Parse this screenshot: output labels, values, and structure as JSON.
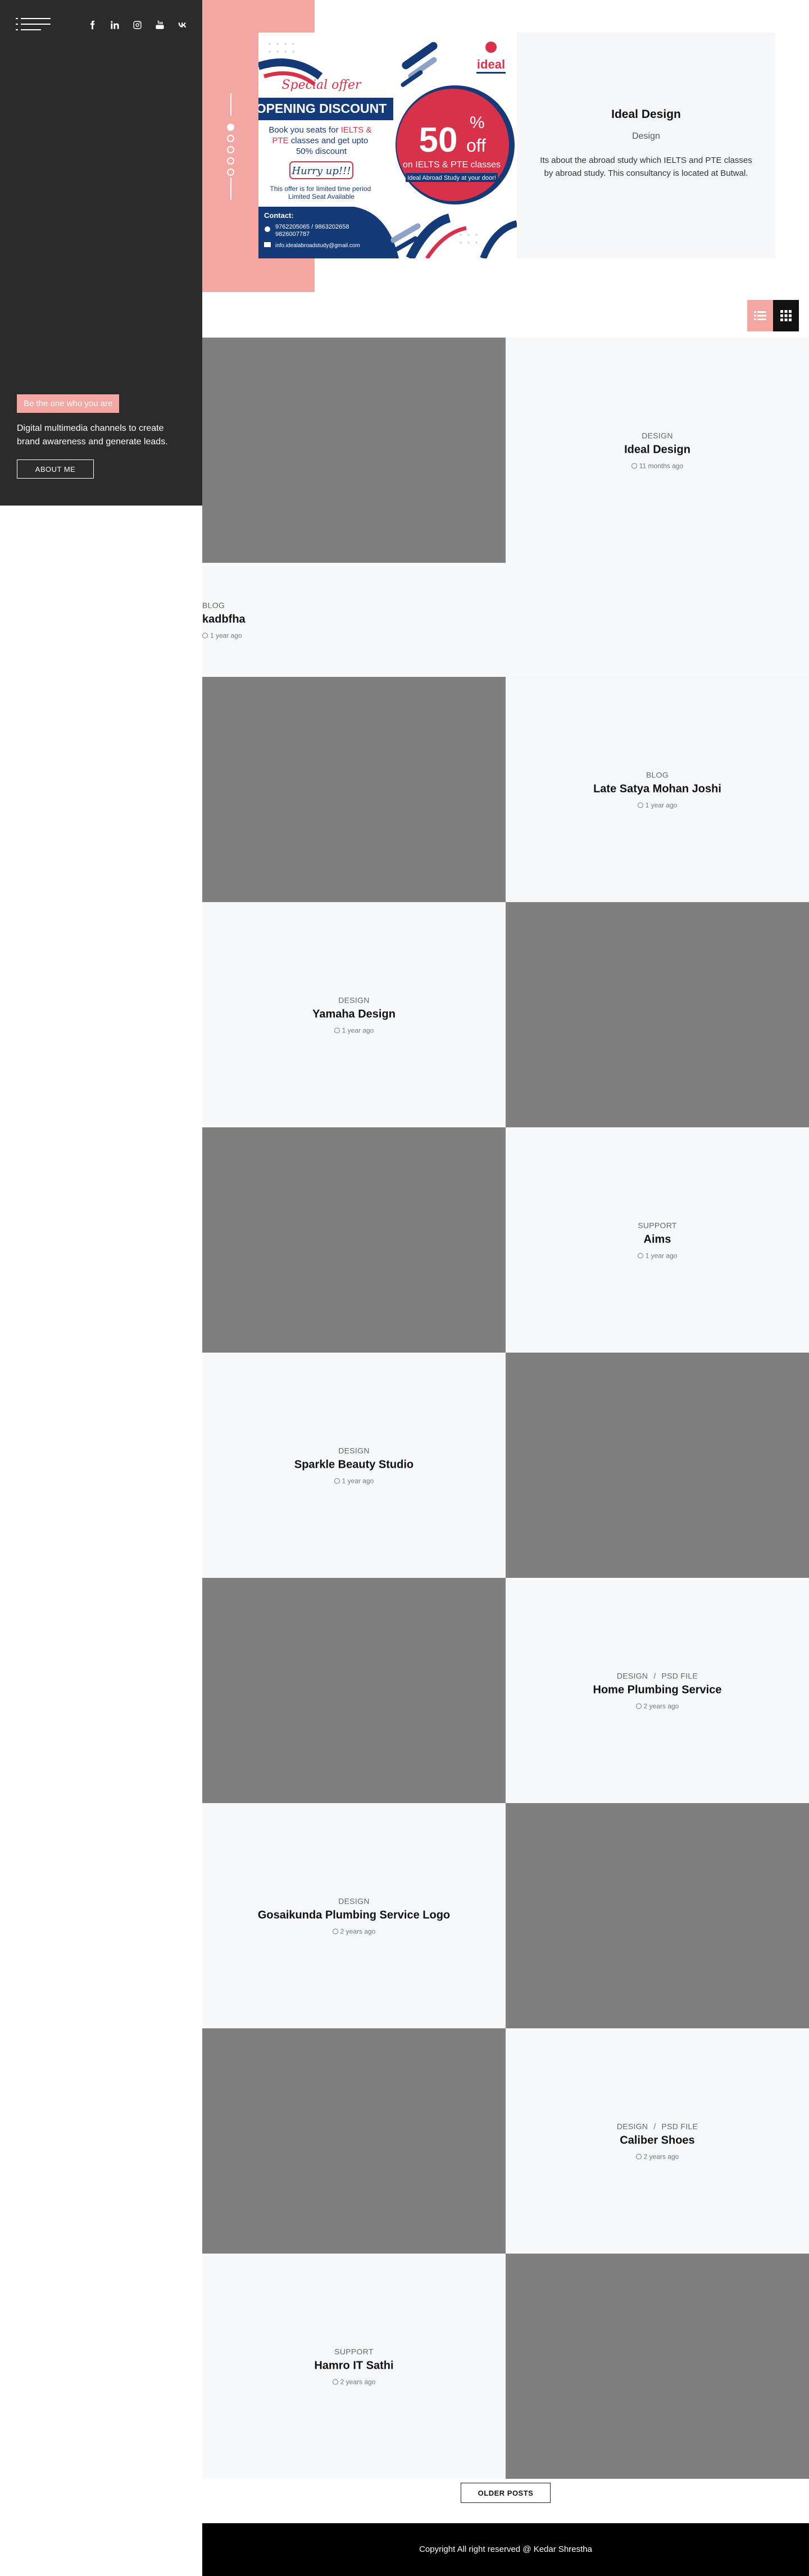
{
  "colors": {
    "sidebar": "#2b2b2b",
    "accent": "#f4a7a2",
    "placeholder": "#7f7f7f",
    "card": "#f7f8fa",
    "footer": "#000000"
  },
  "sidebar": {
    "menu_icon": "menu-icon",
    "socials": [
      "facebook-icon",
      "linkedin-icon",
      "instagram-icon",
      "youtube-icon",
      "vk-icon"
    ],
    "tagline_badge": "Be the one who you are",
    "tagline_text": "Digital multimedia channels to create brand awareness and generate leads.",
    "about_button": "ABOUT ME"
  },
  "hero": {
    "slides_count": 5,
    "active_slide": 1,
    "image": {
      "special_offer": "Special offer",
      "heading": "OPENING DISCOUNT",
      "body": "Book you seats for IELTS & PTE classes and get upto 50% discount",
      "hurry": "Hurry up!!!",
      "note": "This offer is for limited time period\nLimited Seat Available",
      "contact_label": "Contact:",
      "phone": "9762205065 / 9863202658\n9826007787",
      "email": "info.idealabroadstudy@gmail.com",
      "big_number": "50",
      "percent": "%",
      "off": "off",
      "on_text": "on IELTS & PTE classes",
      "brand_line": "Ideal Abroad Study at your door!",
      "logo": "ideal"
    },
    "title": "Ideal Design",
    "category": "Design",
    "description": "Its about the abroad study which IELTS and PTE classes by abroad study. This consultancy is located at Butwal."
  },
  "view_toggle": {
    "list_icon": "list-view-icon",
    "grid_icon": "grid-view-icon"
  },
  "posts": [
    {
      "categories": [
        "DESIGN"
      ],
      "title": "Ideal Design",
      "date": "11 months ago"
    },
    {
      "categories": [
        "BLOG"
      ],
      "title": "kadbfha",
      "date": "1 year ago"
    },
    {
      "categories": [
        "BLOG"
      ],
      "title": "Late Satya Mohan Joshi",
      "date": "1 year ago"
    },
    {
      "categories": [
        "DESIGN"
      ],
      "title": "Yamaha Design",
      "date": "1 year ago"
    },
    {
      "categories": [
        "SUPPORT"
      ],
      "title": "Aims",
      "date": "1 year ago"
    },
    {
      "categories": [
        "DESIGN"
      ],
      "title": "Sparkle Beauty Studio",
      "date": "1 year ago"
    },
    {
      "categories": [
        "DESIGN",
        "PSD FILE"
      ],
      "title": "Home Plumbing Service",
      "date": "2 years ago"
    },
    {
      "categories": [
        "DESIGN"
      ],
      "title": "Gosaikunda Plumbing Service Logo",
      "date": "2 years ago"
    },
    {
      "categories": [
        "DESIGN",
        "PSD FILE"
      ],
      "title": "Caliber Shoes",
      "date": "2 years ago"
    },
    {
      "categories": [
        "SUPPORT"
      ],
      "title": "Hamro IT Sathi",
      "date": "2 years ago"
    }
  ],
  "older_posts": "OLDER POSTS",
  "footer": "Copyright All right reserved @ Kedar Shrestha"
}
